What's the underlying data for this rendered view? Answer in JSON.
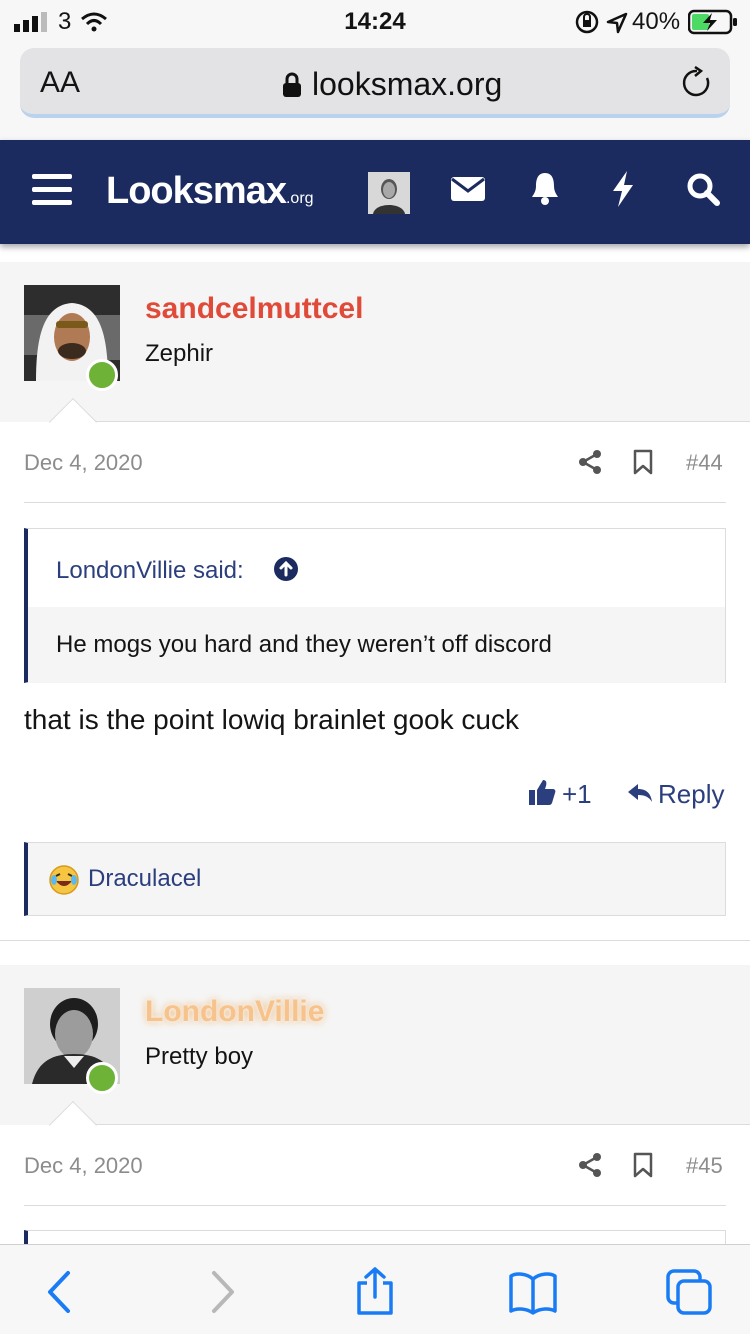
{
  "status_bar": {
    "carrier": "3",
    "time": "14:24",
    "battery": "40%"
  },
  "browser": {
    "text_size_label": "AA",
    "url": "looksmax.org",
    "icons": [
      "lock-icon",
      "reload-icon"
    ]
  },
  "site_header": {
    "logo_main": "Looksmax",
    "logo_suffix": ".org",
    "icons": [
      "menu-icon",
      "user-avatar",
      "envelope-icon",
      "bell-icon",
      "bolt-icon",
      "search-icon"
    ]
  },
  "posts": [
    {
      "username": "sandcelmuttcel",
      "username_color": "#e04a39",
      "user_title": "Zephir",
      "date": "Dec 4, 2020",
      "post_number": "#44",
      "quote": {
        "author_line": "LondonVillie said:",
        "text": "He mogs you hard and they weren’t off discord"
      },
      "body": "that is the point lowiq brainlet gook cuck",
      "like_count": "+1",
      "reply_label": "Reply",
      "reaction_user": "Draculacel"
    },
    {
      "username": "LondonVillie",
      "username_color": "#f6c38c",
      "user_title": "Pretty boy",
      "date": "Dec 4, 2020",
      "post_number": "#45"
    }
  ],
  "toolbar": {
    "icons": [
      "back-icon",
      "forward-icon",
      "share-icon",
      "bookmarks-icon",
      "tabs-icon"
    ]
  },
  "colors": {
    "brand": "#1b2b5f",
    "link": "#2b3f7e",
    "ios_blue": "#1a7cf5",
    "online": "#6fb238"
  }
}
